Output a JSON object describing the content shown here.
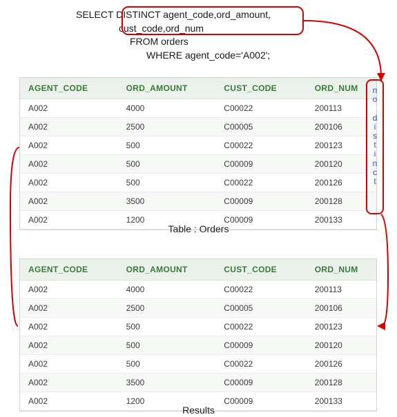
{
  "sql": {
    "select_keyword": "SELECT",
    "distinct_fields": "DISTINCT agent_code,ord_amount,",
    "distinct_fields2": "cust_code,ord_num",
    "from_clause": "FROM orders",
    "where_clause": "WHERE agent_code='A002';"
  },
  "annotation": {
    "no_distinct": "no distinct"
  },
  "columns": {
    "c0": "AGENT_CODE",
    "c1": "ORD_AMOUNT",
    "c2": "CUST_CODE",
    "c3": "ORD_NUM"
  },
  "tables": {
    "orders": {
      "caption": "Table : Orders",
      "rows": [
        {
          "a": "A002",
          "b": "4000",
          "c": "C00022",
          "d": "200113"
        },
        {
          "a": "A002",
          "b": "2500",
          "c": "C00005",
          "d": "200106"
        },
        {
          "a": "A002",
          "b": "500",
          "c": "C00022",
          "d": "200123"
        },
        {
          "a": "A002",
          "b": "500",
          "c": "C00009",
          "d": "200120"
        },
        {
          "a": "A002",
          "b": "500",
          "c": "C00022",
          "d": "200126"
        },
        {
          "a": "A002",
          "b": "3500",
          "c": "C00009",
          "d": "200128"
        },
        {
          "a": "A002",
          "b": "1200",
          "c": "C00009",
          "d": "200133"
        }
      ]
    },
    "results": {
      "caption": "Results",
      "rows": [
        {
          "a": "A002",
          "b": "4000",
          "c": "C00022",
          "d": "200113"
        },
        {
          "a": "A002",
          "b": "2500",
          "c": "C00005",
          "d": "200106"
        },
        {
          "a": "A002",
          "b": "500",
          "c": "C00022",
          "d": "200123"
        },
        {
          "a": "A002",
          "b": "500",
          "c": "C00009",
          "d": "200120"
        },
        {
          "a": "A002",
          "b": "500",
          "c": "C00022",
          "d": "200126"
        },
        {
          "a": "A002",
          "b": "3500",
          "c": "C00009",
          "d": "200128"
        },
        {
          "a": "A002",
          "b": "1200",
          "c": "C00009",
          "d": "200133"
        }
      ]
    }
  },
  "chart_data": {
    "type": "table",
    "title": "SQL SELECT DISTINCT on multiple columns (same as non-distinct because all rows are unique)",
    "columns": [
      "AGENT_CODE",
      "ORD_AMOUNT",
      "CUST_CODE",
      "ORD_NUM"
    ],
    "source_rows": [
      [
        "A002",
        4000,
        "C00022",
        200113
      ],
      [
        "A002",
        2500,
        "C00005",
        200106
      ],
      [
        "A002",
        500,
        "C00022",
        200123
      ],
      [
        "A002",
        500,
        "C00009",
        200120
      ],
      [
        "A002",
        500,
        "C00022",
        200126
      ],
      [
        "A002",
        3500,
        "C00009",
        200128
      ],
      [
        "A002",
        1200,
        "C00009",
        200133
      ]
    ],
    "result_rows": [
      [
        "A002",
        4000,
        "C00022",
        200113
      ],
      [
        "A002",
        2500,
        "C00005",
        200106
      ],
      [
        "A002",
        500,
        "C00022",
        200123
      ],
      [
        "A002",
        500,
        "C00009",
        200120
      ],
      [
        "A002",
        500,
        "C00022",
        200126
      ],
      [
        "A002",
        3500,
        "C00009",
        200128
      ],
      [
        "A002",
        1200,
        "C00009",
        200133
      ]
    ]
  }
}
